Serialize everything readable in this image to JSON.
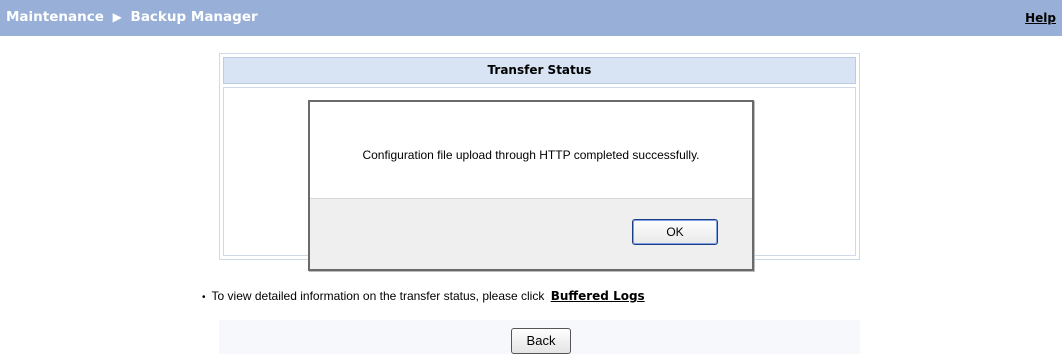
{
  "header": {
    "section": "Maintenance",
    "separator": "▶",
    "page": "Backup Manager",
    "help_label": "Help"
  },
  "status_panel": {
    "title": "Transfer Status"
  },
  "dialog": {
    "message": "Configuration file upload through HTTP completed successfully.",
    "ok_label": "OK"
  },
  "info": {
    "bullet": "•",
    "text": "To view detailed information on the transfer status, please click",
    "link_label": "Buffered Logs"
  },
  "footer": {
    "back_label": "Back"
  }
}
